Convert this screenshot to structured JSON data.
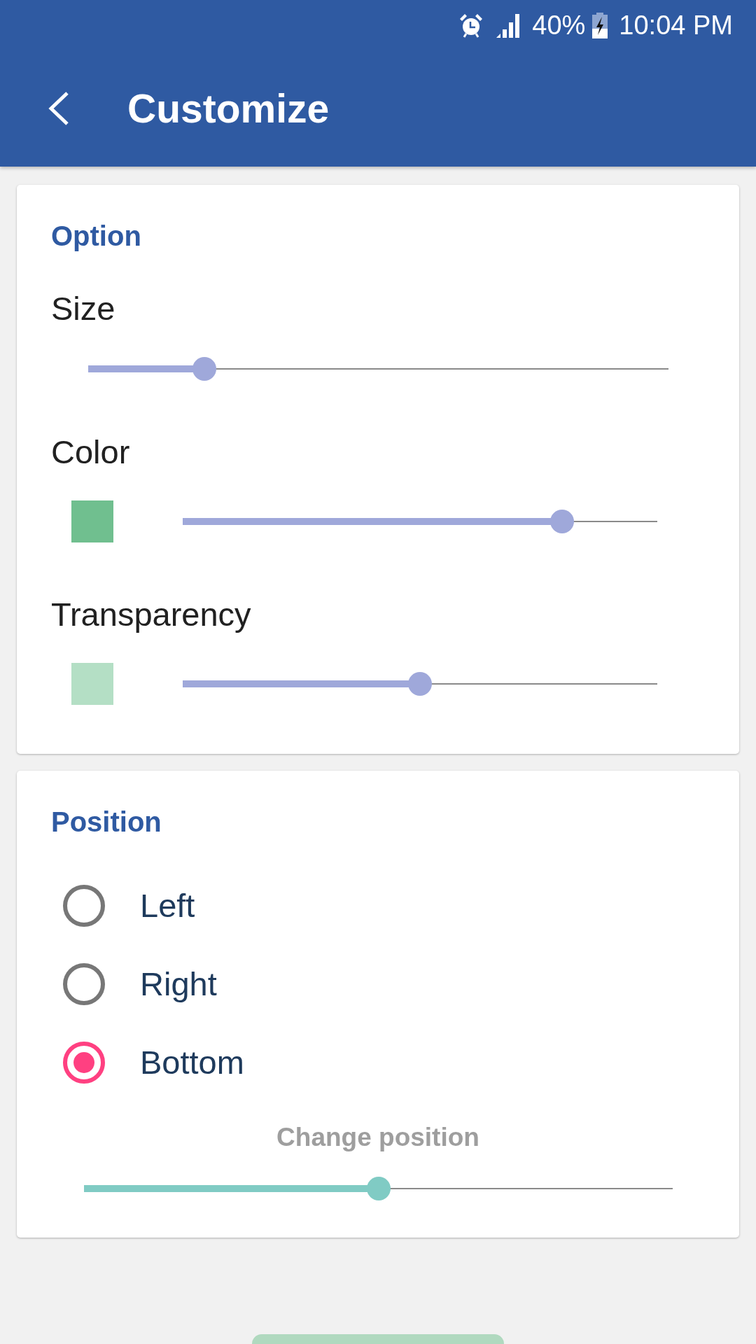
{
  "status_bar": {
    "battery_percent": "40%",
    "time": "10:04 PM"
  },
  "toolbar": {
    "title": "Customize"
  },
  "option_card": {
    "title": "Option",
    "settings": [
      {
        "kind": "slider",
        "label": "Size",
        "level": 0.2
      },
      {
        "kind": "swatch-slider",
        "label": "Color",
        "color": "#70bf8f",
        "level": 0.8
      },
      {
        "kind": "swatch-slider",
        "label": "Transparency",
        "color": "#b4dfc5",
        "level": 0.5
      }
    ]
  },
  "position_card": {
    "title": "Position",
    "options": [
      {
        "label": "Left",
        "selected": false
      },
      {
        "label": "Right",
        "selected": false
      },
      {
        "label": "Bottom",
        "selected": true
      }
    ],
    "slider": {
      "label": "Change position",
      "level": 0.5
    }
  }
}
